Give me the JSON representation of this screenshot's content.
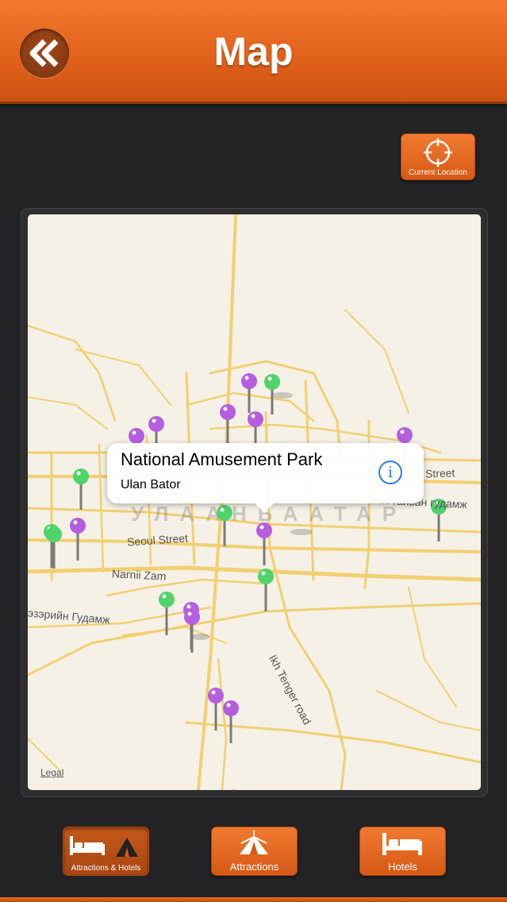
{
  "header": {
    "title": "Map"
  },
  "current_location": {
    "label": "Current Location"
  },
  "map": {
    "legal": "Legal",
    "streets": {
      "seoul_street": "Seoul Street",
      "narnii_zam": "Narnii Zam",
      "ikh_tenger": "Ikh Tenger road",
      "street_right": "Street",
      "enkh_taivan": "Энх тайван гудамж",
      "zairin": "эзэрийн Гудамж",
      "city_label": "УЛААНБААТАР"
    }
  },
  "callout": {
    "title": "National Amusement Park",
    "subtitle": "Ulan Bator"
  },
  "tabs": [
    {
      "label": "Attractions & Hotels"
    },
    {
      "label": "Attractions"
    },
    {
      "label": "Hotels"
    }
  ],
  "colors": {
    "accent": "#e0601a",
    "pin_green": "#4fd46a",
    "pin_purple": "#b55ee0",
    "road": "#f2cf72"
  }
}
